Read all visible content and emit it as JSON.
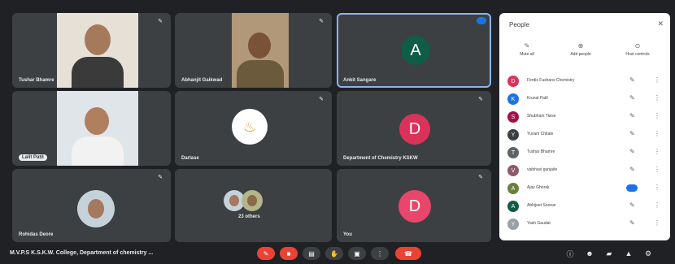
{
  "tiles": [
    {
      "name": "Tushar Bhamre"
    },
    {
      "name": "Abhanjit Gaikwad"
    },
    {
      "name": "Ankit Sangare",
      "initial": "A",
      "color": "#0f5d46"
    },
    {
      "name": "Lalit Patil"
    },
    {
      "name": "Darlase"
    },
    {
      "name": "Department of Chemistry KSKW",
      "initial": "D",
      "color": "#d9335a"
    },
    {
      "name": "Rohidas Deore"
    },
    {
      "name": "",
      "count_label": "23 others"
    },
    {
      "name": "You",
      "initial": "D",
      "color": "#e8466a"
    }
  ],
  "bottom": {
    "meeting_title": "M.V.P.S K.S.K.W. College, Department of chemistry ..."
  },
  "panel": {
    "title": "People",
    "actions": [
      "Mute all",
      "Add people",
      "Host controls"
    ],
    "participants": [
      {
        "name": "Ferdis Fushans Chemistry",
        "color": "#d9335a",
        "initial": "D"
      },
      {
        "name": "Krunal Patil",
        "color": "#1a73e8",
        "initial": "K"
      },
      {
        "name": "Shubham Tiwse",
        "color": "#a50e4b",
        "initial": "S"
      },
      {
        "name": "Yuvam Chitale",
        "color": "#3c4043",
        "initial": "Y"
      },
      {
        "name": "Tushar Bhamre",
        "color": "#5f6368",
        "initial": "T"
      },
      {
        "name": "vaibhavi gunjaite",
        "color": "#8e5a6b",
        "initial": "V"
      },
      {
        "name": "Ajay Ghorak",
        "color": "#6a7f3a",
        "initial": "A"
      },
      {
        "name": "Abhijeet Soonar",
        "color": "#0f5d46",
        "initial": "A"
      },
      {
        "name": "Yash Gaudat",
        "color": "#9aa0a6",
        "initial": "Y"
      }
    ]
  }
}
